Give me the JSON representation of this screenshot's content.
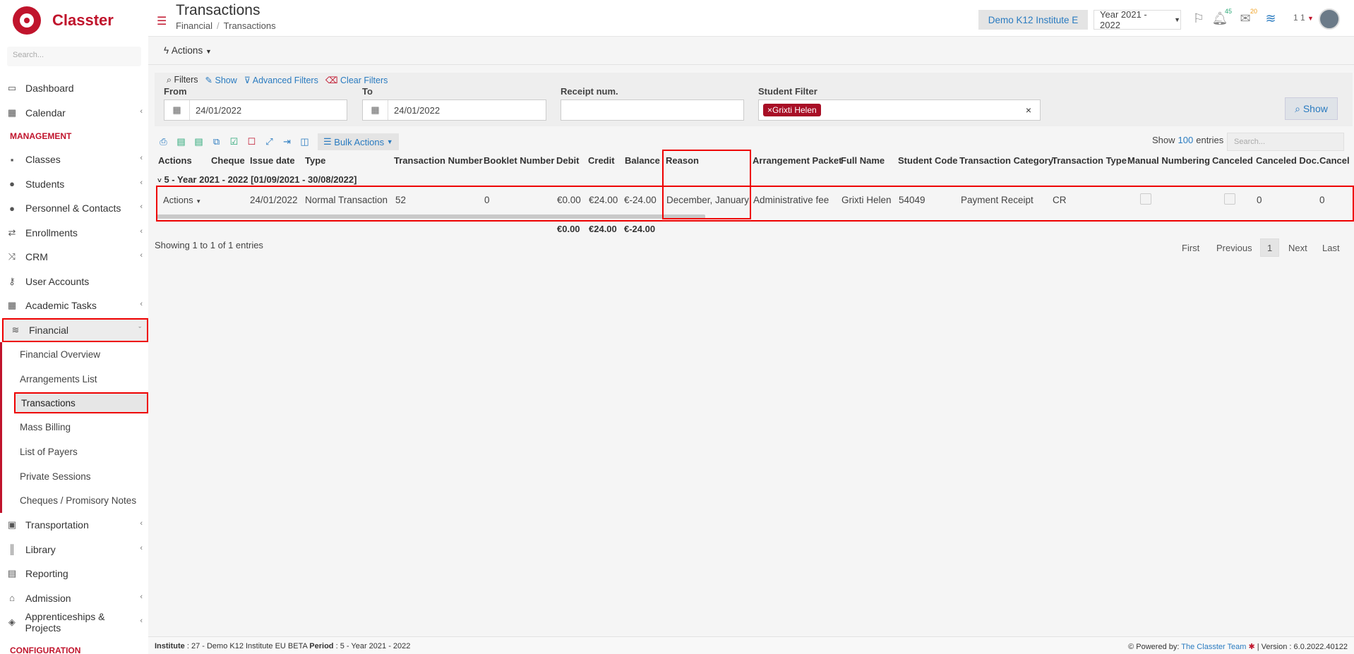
{
  "app": {
    "name": "Classter"
  },
  "sidebar": {
    "search_placeholder": "Search...",
    "items": [
      {
        "label": "Dashboard",
        "icon": "laptop-icon"
      },
      {
        "label": "Calendar",
        "icon": "calendar-icon"
      }
    ],
    "management_header": "MANAGEMENT",
    "management_items": [
      {
        "label": "Classes"
      },
      {
        "label": "Students"
      },
      {
        "label": "Personnel & Contacts"
      },
      {
        "label": "Enrollments"
      },
      {
        "label": "CRM"
      },
      {
        "label": "User Accounts"
      },
      {
        "label": "Academic Tasks"
      },
      {
        "label": "Financial"
      }
    ],
    "financial_sub": [
      {
        "label": "Financial Overview"
      },
      {
        "label": "Arrangements List"
      },
      {
        "label": "Transactions"
      },
      {
        "label": "Mass Billing"
      },
      {
        "label": "List of Payers"
      },
      {
        "label": "Private Sessions"
      },
      {
        "label": "Cheques / Promisory Notes"
      }
    ],
    "more_items": [
      {
        "label": "Transportation"
      },
      {
        "label": "Library"
      },
      {
        "label": "Reporting"
      },
      {
        "label": "Admission"
      },
      {
        "label": "Apprenticeships & Projects"
      }
    ],
    "config_header": "CONFIGURATION"
  },
  "header": {
    "title": "Transactions",
    "breadcrumb": [
      "Financial",
      "Transactions"
    ],
    "institute_button": "Demo K12 Institute E",
    "year_select": "Year 2021 - 2022",
    "notif_count": "45",
    "mail_count": "20",
    "user_num": "1 1"
  },
  "toolbar": {
    "actions_label": "Actions"
  },
  "filters": {
    "filters_label": "Filters",
    "show_link": "Show",
    "advanced_link": "Advanced Filters",
    "clear_link": "Clear Filters",
    "from_label": "From",
    "from_value": "24/01/2022",
    "to_label": "To",
    "to_value": "24/01/2022",
    "receipt_label": "Receipt num.",
    "receipt_value": "",
    "student_label": "Student Filter",
    "student_tag": "Grixti Helen",
    "show_button": "Show"
  },
  "grid": {
    "bulk_actions": "Bulk Actions",
    "show_label": "Show",
    "entries_count": "100",
    "entries_label": "entries",
    "search_placeholder": "Search...",
    "columns": [
      "Actions",
      "Cheque",
      "Issue date",
      "Type",
      "Transaction Number",
      "Booklet Number",
      "Debit",
      "Credit",
      "Balance",
      "Reason",
      "Arrangement Packet",
      "Full Name",
      "Student Code",
      "Transaction Category",
      "Transaction Type",
      "Manual Numbering",
      "Canceled",
      "Canceled Doc.",
      "Cancel"
    ],
    "group_label": "5 - Year 2021 - 2022 [01/09/2021 - 30/08/2022]",
    "row": {
      "actions": "Actions",
      "issue_date": "24/01/2022",
      "type": "Normal Transaction",
      "transaction_number": "52",
      "booklet_number": "0",
      "debit": "€0.00",
      "credit": "€24.00",
      "balance": "€-24.00",
      "reason": "December, January",
      "arrangement_packet": "Administrative fee",
      "full_name": "Grixti Helen",
      "student_code": "54049",
      "transaction_category": "Payment Receipt",
      "transaction_type": "CR",
      "canceled_doc": "0",
      "cancel_col": "0"
    },
    "totals": {
      "debit": "€0.00",
      "credit": "€24.00",
      "balance": "€-24.00"
    },
    "showing": "Showing 1 to 1 of 1 entries",
    "pager": {
      "first": "First",
      "previous": "Previous",
      "current": "1",
      "next": "Next",
      "last": "Last"
    }
  },
  "footer": {
    "institute_label": "Institute",
    "institute_value": ": 27 - Demo K12 Institute EU BETA",
    "period_label": "Period",
    "period_value": ": 5 - Year 2021 - 2022",
    "powered": "Powered by:",
    "team": "The Classter Team",
    "version": "| Version : 6.0.2022.40122"
  },
  "colors": {
    "brand": "#c0142c",
    "link": "#2a7bc0",
    "highlight": "#ee0000"
  }
}
